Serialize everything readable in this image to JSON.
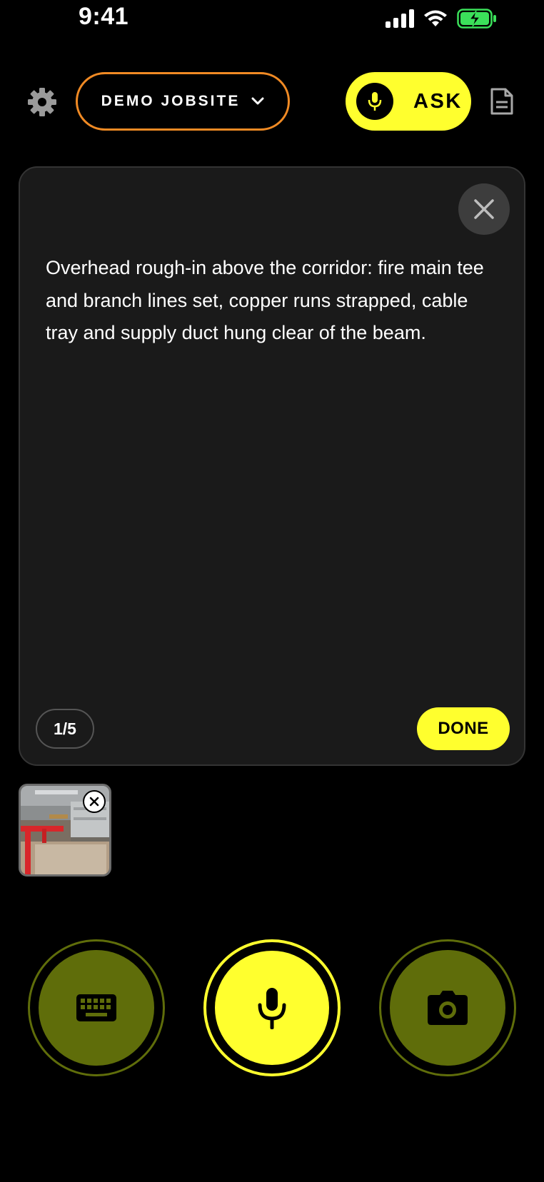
{
  "status_bar": {
    "time": "9:41"
  },
  "header": {
    "jobsite_label": "DEMO JOBSITE",
    "ask_label": "ASK"
  },
  "note": {
    "text": "Overhead rough-in above the corridor: fire main tee and branch lines set, copper runs strapped, cable tray and supply duct hung clear of the beam.",
    "page_counter": "1/5",
    "done_label": "DONE"
  },
  "icons": {
    "settings": "gear-icon",
    "jobsite_dropdown": "chevron-down-icon",
    "ask": "microphone-icon",
    "document": "document-icon",
    "close": "close-icon",
    "keyboard": "keyboard-icon",
    "record": "microphone-icon",
    "camera": "camera-icon"
  },
  "colors": {
    "accent_yellow": "#ffff2e",
    "jobsite_border": "#f08a24",
    "control_olive": "#5f6d0a",
    "card_bg": "#1a1a1a",
    "battery_green": "#3be05a"
  }
}
